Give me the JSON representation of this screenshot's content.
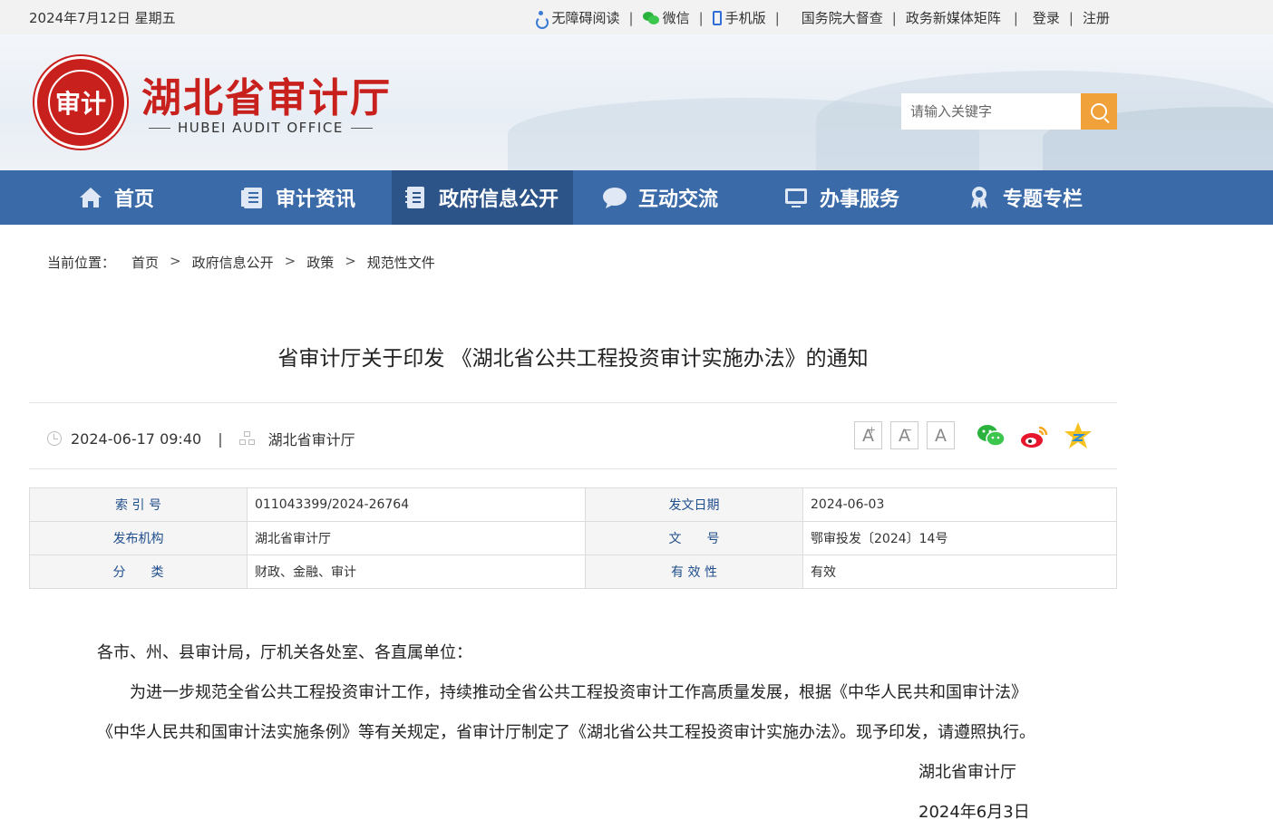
{
  "topbar": {
    "date": "2024年7月12日 星期五",
    "accessibility": "无障碍阅读",
    "wechat": "微信",
    "mobile": "手机版",
    "supervision": "国务院大督查",
    "media_matrix": "政务新媒体矩阵",
    "login": "登录",
    "register": "注册"
  },
  "header": {
    "logo_text": "审计",
    "site_title": "湖北省审计厅",
    "site_subtitle": "HUBEI AUDIT OFFICE",
    "search_placeholder": "请输入关键字"
  },
  "nav": {
    "items": [
      {
        "label": "首页",
        "icon": "home-icon"
      },
      {
        "label": "审计资讯",
        "icon": "document-icon"
      },
      {
        "label": "政府信息公开",
        "icon": "notebook-icon",
        "active": true
      },
      {
        "label": "互动交流",
        "icon": "chat-bubble-icon"
      },
      {
        "label": "办事服务",
        "icon": "monitor-icon"
      },
      {
        "label": "专题专栏",
        "icon": "medal-icon"
      }
    ]
  },
  "breadcrumb": {
    "prefix": "当前位置：",
    "items": [
      "首页",
      "政府信息公开",
      "政策",
      "规范性文件"
    ]
  },
  "article": {
    "title": "省审计厅关于印发 《湖北省公共工程投资审计实施办法》的通知",
    "datetime": "2024-06-17 09:40",
    "source": "湖北省审计厅",
    "font_buttons": [
      "A",
      "A",
      "A"
    ],
    "share": [
      "wechat-share-icon",
      "weibo-share-icon",
      "qzone-share-icon"
    ]
  },
  "info_table": {
    "rows": [
      {
        "k1": "索 引 号",
        "v1": "011043399/2024-26764",
        "k2": "发文日期",
        "v2": "2024-06-03"
      },
      {
        "k1": "发布机构",
        "v1": "湖北省审计厅",
        "k2": "文　　号",
        "v2": "鄂审投发〔2024〕14号"
      },
      {
        "k1": "分　　类",
        "v1": "财政、金融、审计",
        "k2": "有 效 性",
        "v2": "有效"
      }
    ]
  },
  "body": {
    "salutation": "各市、州、县审计局，厅机关各处室、各直属单位：",
    "para1": "为进一步规范全省公共工程投资审计工作，持续推动全省公共工程投资审计工作高质量发展，根据《中华人民共和国审计法》",
    "para2": "《中华人民共和国审计法实施条例》等有关规定，省审计厅制定了《湖北省公共工程投资审计实施办法》。现予印发，请遵照执行。",
    "signature": "湖北省审计厅",
    "sign_date": "2024年6月3日"
  },
  "colors": {
    "nav_bg": "#3b6aa8",
    "nav_active": "#2c5488",
    "brand_red": "#c8201c",
    "search_button": "#f0a13a",
    "table_key": "#1f4e8c"
  }
}
